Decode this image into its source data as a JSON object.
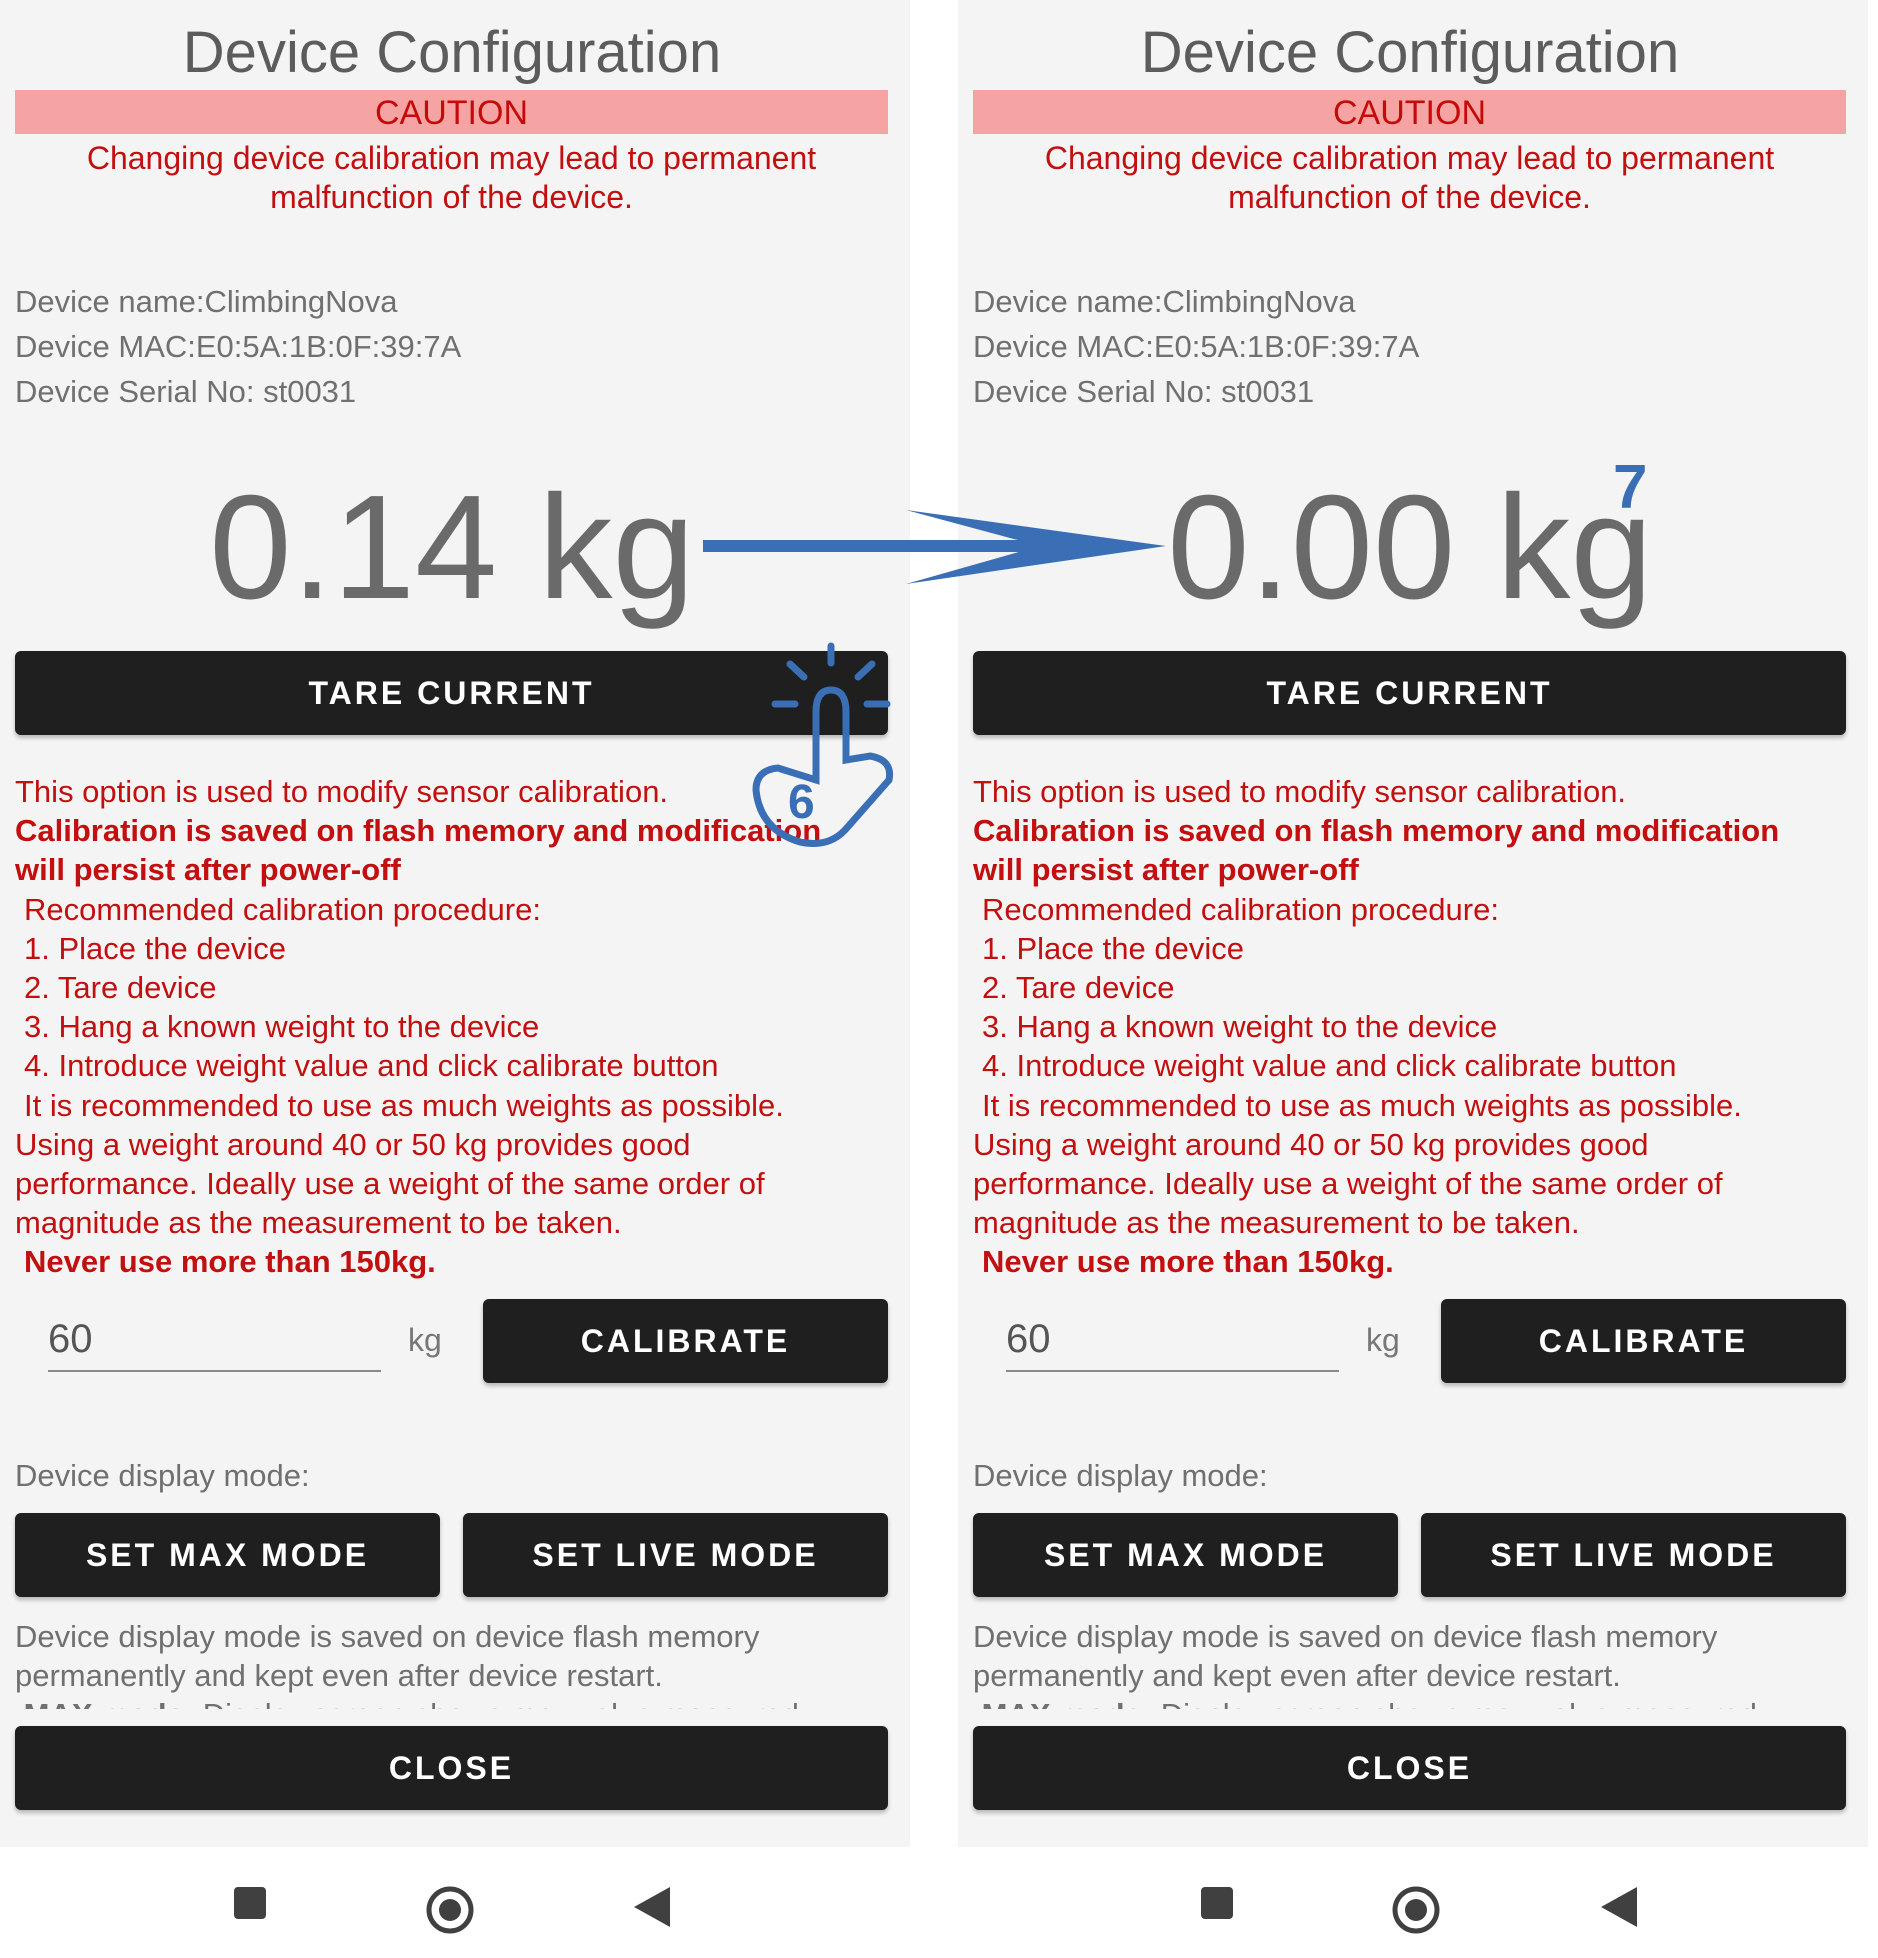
{
  "screens": [
    {
      "title": "Device Configuration",
      "caution_title": "CAUTION",
      "caution_message": "Changing device calibration may lead to permanent malfunction of the device.",
      "device_name": "Device name:ClimbingNova",
      "device_mac": "Device MAC:E0:5A:1B:0F:39:7A",
      "device_serial": "Device Serial No: st0031",
      "weight_reading": "0.14 kg",
      "tare_label": "TARE CURRENT",
      "description": {
        "line1": "This option is used to modify sensor calibration.",
        "line2": "Calibration is saved on flash memory and modification",
        "line3": "will persist after power-off",
        "line4": "Recommended calibration procedure:",
        "line5": "1. Place the device",
        "line6": "2. Tare device",
        "line7": "3. Hang a known weight to the device",
        "line8": "4. Introduce weight value and click calibrate button",
        "line9": "It is recommended to use as much weights as possible.",
        "line10": "Using a weight around 40 or 50 kg provides good",
        "line11": "performance. Ideally use a weight of the same order of",
        "line12": "magnitude as the measurement to be taken.",
        "line13": "Never use more than 150kg."
      },
      "calibration_weight_value": "60",
      "unit": "kg",
      "calibrate_label": "CALIBRATE",
      "display_mode_label": "Device display mode:",
      "max_mode_label": "SET MAX MODE",
      "live_mode_label": "SET LIVE MODE",
      "mode_note_line1": "Device display mode is saved on device flash memory",
      "mode_note_line2": "permanently and kept even after device restart.",
      "mode_note_cut_bold": "MAX mode:",
      "mode_note_cut_rest": "Display screen shows max value measured",
      "close_label": "CLOSE"
    },
    {
      "title": "Device Configuration",
      "caution_title": "CAUTION",
      "caution_message": "Changing device calibration may lead to permanent malfunction of the device.",
      "device_name": "Device name:ClimbingNova",
      "device_mac": "Device MAC:E0:5A:1B:0F:39:7A",
      "device_serial": "Device Serial No: st0031",
      "weight_reading": "0.00 kg",
      "tare_label": "TARE CURRENT",
      "description": {
        "line1": "This option is used to modify sensor calibration.",
        "line2": "Calibration is saved on flash memory and modification",
        "line3": "will persist after power-off",
        "line4": "Recommended calibration procedure:",
        "line5": "1. Place the device",
        "line6": "2. Tare device",
        "line7": "3. Hang a known weight to the device",
        "line8": "4. Introduce weight value and click calibrate button",
        "line9": "It is recommended to use as much weights as possible.",
        "line10": "Using a weight around 40 or 50 kg provides good",
        "line11": "performance. Ideally use a weight of the same order of",
        "line12": "magnitude as the measurement to be taken.",
        "line13": "Never use more than 150kg."
      },
      "calibration_weight_value": "60",
      "unit": "kg",
      "calibrate_label": "CALIBRATE",
      "display_mode_label": "Device display mode:",
      "max_mode_label": "SET MAX MODE",
      "live_mode_label": "SET LIVE MODE",
      "mode_note_line1": "Device display mode is saved on device flash memory",
      "mode_note_line2": "permanently and kept even after device restart.",
      "mode_note_cut_bold": "MAX mode:",
      "mode_note_cut_rest": "Display screen shows max value measured",
      "close_label": "CLOSE"
    }
  ],
  "annotations": {
    "tap_step": "6",
    "result_step": "7"
  },
  "colors": {
    "accent_annotation": "#3a6fb6",
    "warning_red": "#c20f0f",
    "caution_bg": "#f5a3a3",
    "button_bg": "#1f1f1f"
  },
  "icons": [
    "stop-square-icon",
    "home-circle-icon",
    "back-triangle-icon",
    "tap-hand-icon",
    "arrow-right-icon"
  ]
}
